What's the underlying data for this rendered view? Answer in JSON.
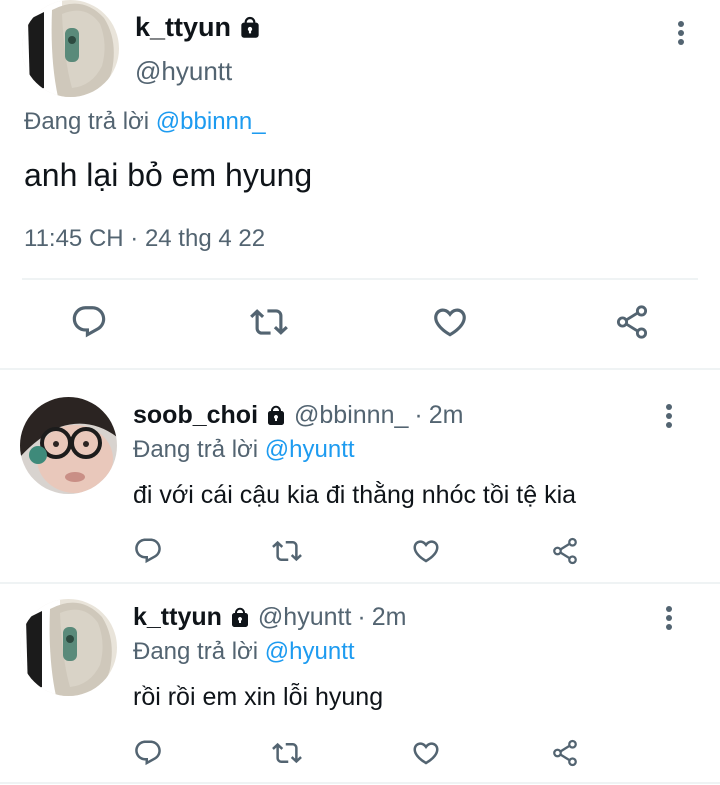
{
  "main_tweet": {
    "display_name": "k_ttyun",
    "handle": "@hyuntt",
    "replying_prefix": "Đang trả lời",
    "replying_to": "@bbinnn_",
    "text": "anh lại bỏ em hyung",
    "timestamp": "11:45 CH · 24 thg 4 22"
  },
  "replies": [
    {
      "display_name": "soob_choi",
      "handle": "@bbinnn_",
      "dot": "·",
      "time": "2m",
      "replying_prefix": "Đang trả lời",
      "replying_to": "@hyuntt",
      "text": "đi với cái cậu kia đi thằng nhóc tồi tệ kia"
    },
    {
      "display_name": "k_ttyun",
      "handle": "@hyuntt",
      "dot": "·",
      "time": "2m",
      "replying_prefix": "Đang trả lời",
      "replying_to": "@hyuntt",
      "text": "rồi rồi em xin lỗi hyung"
    }
  ],
  "icons": {
    "reply": "reply-icon",
    "retweet": "retweet-icon",
    "like": "heart-icon",
    "share": "share-icon",
    "more": "more-vertical-icon",
    "lock": "lock-icon"
  },
  "colors": {
    "text": "#0f1419",
    "muted": "#536471",
    "mention": "#1d9bf0",
    "divider": "#eff3f4",
    "icon": "#536471"
  }
}
